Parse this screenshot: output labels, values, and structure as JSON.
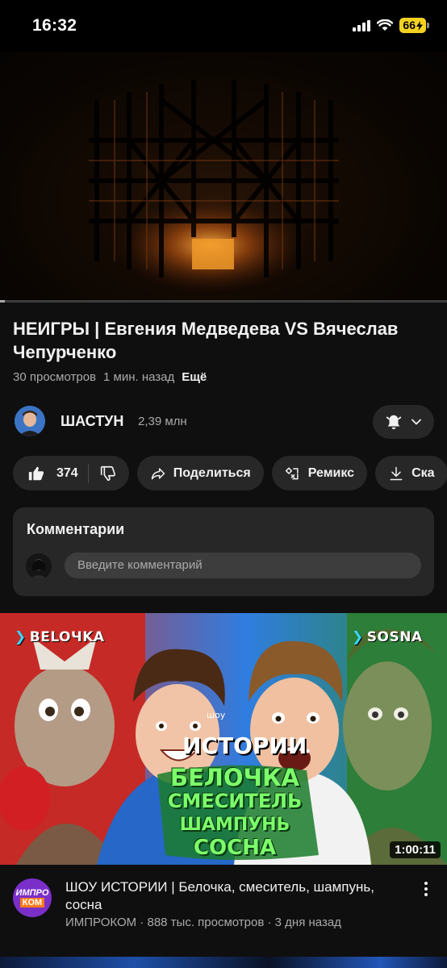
{
  "status_bar": {
    "time": "16:32",
    "battery": "66"
  },
  "video": {
    "title": "НЕИГРЫ | Евгения Медведева VS Вячеслав Чепурченко",
    "views": "30 просмотров",
    "age": "1 мин. назад",
    "more": "Ещё",
    "progress": 0.01
  },
  "channel": {
    "name": "ШАСТУН",
    "subscribers": "2,39 млн"
  },
  "actions": {
    "likes": "374",
    "share": "Поделиться",
    "remix": "Ремикс",
    "download": "Ска"
  },
  "comments": {
    "title": "Комментарии",
    "placeholder": "Введите комментарий"
  },
  "recommended": {
    "thumb_left_tag": "BELOЧKA",
    "thumb_right_tag": "SOSNA",
    "thumb_show": "ИСТОРИИ",
    "thumb_show_small": "шоу",
    "thumb_words": [
      "БЕЛОЧКА",
      "СМЕСИТЕЛЬ",
      "ШАМПУНЬ",
      "СОСНА"
    ],
    "duration": "1:00:11",
    "title": "ШОУ ИСТОРИИ | Белочка, смеситель, шампунь, сосна",
    "channel": "ИМПРОКОМ",
    "views": "888 тыс. просмотров",
    "age": "3 дня назад",
    "avatar_text_top": "ИМПРО",
    "avatar_text_bottom": "КОМ"
  },
  "colors": {
    "background": "#0f0f0f",
    "chip": "#272727",
    "battery": "#f4d221",
    "thumb_green": "#39d14a"
  }
}
